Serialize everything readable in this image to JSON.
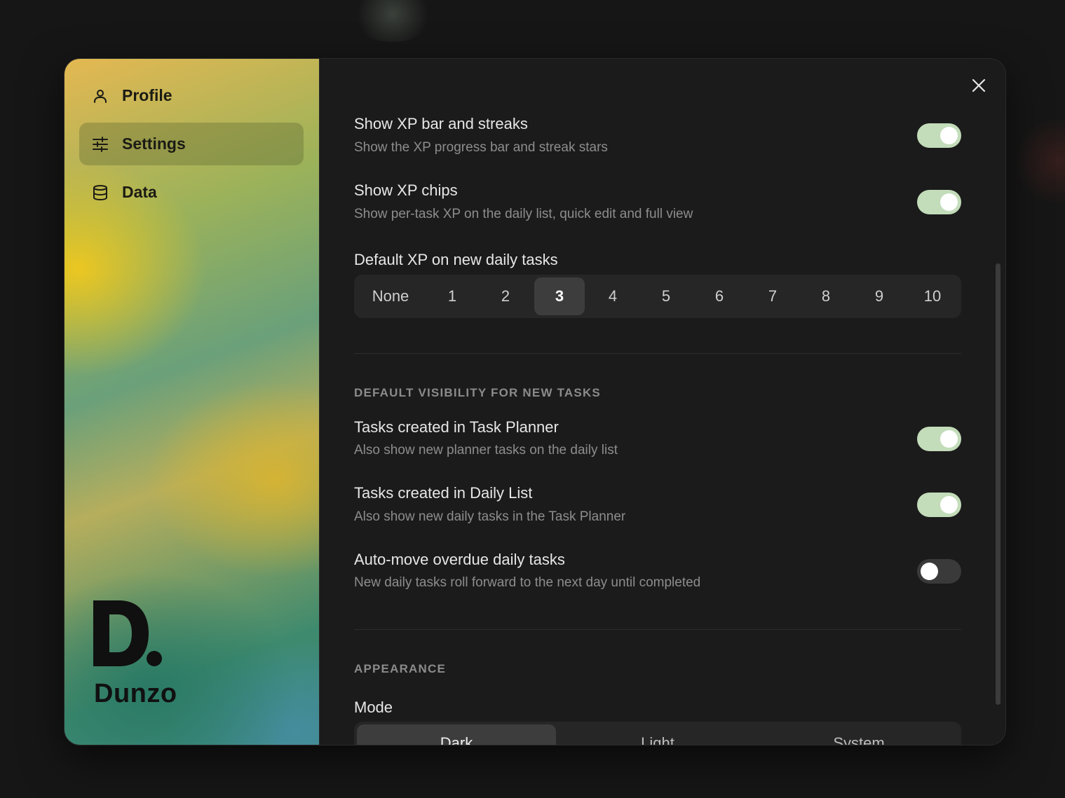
{
  "sidebar": {
    "items": [
      {
        "label": "Profile",
        "icon": "user-icon"
      },
      {
        "label": "Settings",
        "icon": "sliders-icon",
        "active": true
      },
      {
        "label": "Data",
        "icon": "database-icon"
      }
    ],
    "brand": "Dunzo"
  },
  "settings": {
    "xp_bar": {
      "title": "Show XP bar and streaks",
      "desc": "Show the XP progress bar and streak stars",
      "on": true
    },
    "xp_chips": {
      "title": "Show XP chips",
      "desc": "Show per-task XP on the daily list, quick edit and full view",
      "on": true
    },
    "default_xp": {
      "title": "Default XP on new daily tasks",
      "options": [
        "None",
        "1",
        "2",
        "3",
        "4",
        "5",
        "6",
        "7",
        "8",
        "9",
        "10"
      ],
      "selected": "3"
    },
    "visibility_heading": "DEFAULT VISIBILITY FOR NEW TASKS",
    "planner_tasks": {
      "title": "Tasks created in Task Planner",
      "desc": "Also show new planner tasks on the daily list",
      "on": true
    },
    "daily_tasks": {
      "title": "Tasks created in Daily List",
      "desc": "Also show new daily tasks in the Task Planner",
      "on": true
    },
    "auto_move": {
      "title": "Auto-move overdue daily tasks",
      "desc": "New daily tasks roll forward to the next day until completed",
      "on": false
    },
    "appearance_heading": "APPEARANCE",
    "mode": {
      "title": "Mode",
      "options": [
        "Dark",
        "Light",
        "System"
      ],
      "selected": "Dark"
    }
  },
  "colors": {
    "toggle_on": "#c3dcba",
    "toggle_off": "#3a3a3a",
    "accent_selected": "#3d3d3d"
  }
}
